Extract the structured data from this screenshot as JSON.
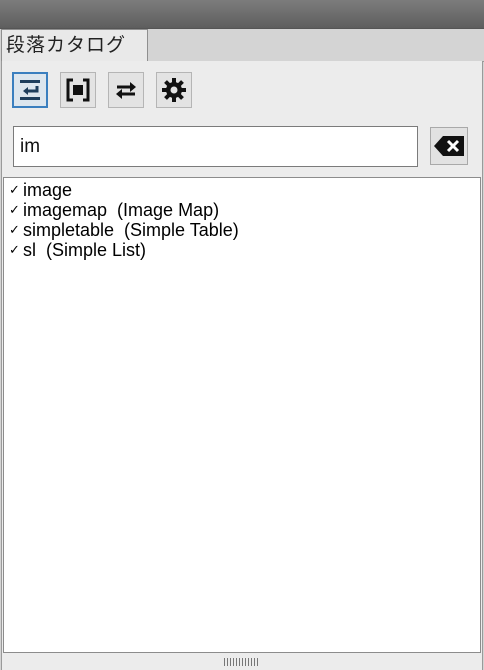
{
  "panel": {
    "tab_label": "段落カタログ"
  },
  "toolbar": {
    "buttons": [
      {
        "name": "insert-before-icon",
        "active": true
      },
      {
        "name": "wrap-icon",
        "active": false
      },
      {
        "name": "swap-arrows-icon",
        "active": false
      },
      {
        "name": "gear-icon",
        "active": false
      }
    ]
  },
  "search": {
    "value": "im",
    "placeholder": ""
  },
  "results": {
    "items": [
      {
        "check": "✓",
        "label": "image"
      },
      {
        "check": "✓",
        "label": "imagemap  (Image Map)"
      },
      {
        "check": "✓",
        "label": "simpletable  (Simple Table)"
      },
      {
        "check": "✓",
        "label": "sl  (Simple List)"
      }
    ]
  },
  "colors": {
    "active_border": "#3b7fbf",
    "panel_bg": "#ececec",
    "topbar": "#6a6a6a"
  }
}
